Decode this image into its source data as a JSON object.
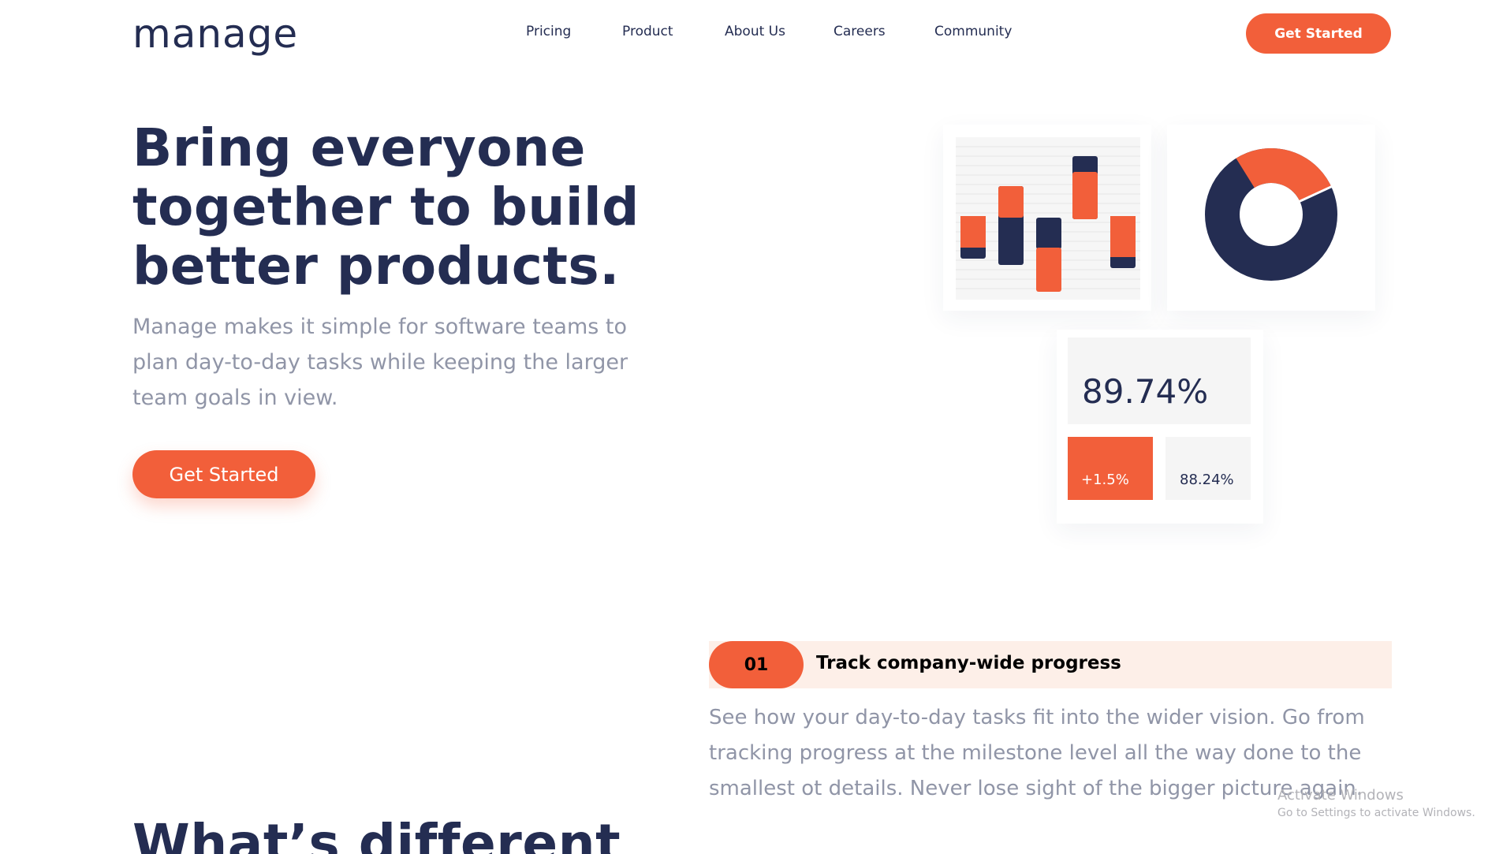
{
  "header": {
    "logo": "manage",
    "nav": [
      {
        "label": "Pricing"
      },
      {
        "label": "Product"
      },
      {
        "label": "About Us"
      },
      {
        "label": "Careers"
      },
      {
        "label": "Community"
      }
    ],
    "cta": "Get Started"
  },
  "hero": {
    "title": "Bring everyone together to build better products.",
    "subtitle": "Manage makes it simple for software teams to plan day-to-day tasks while keeping the larger team goals in view.",
    "cta": "Get Started"
  },
  "dashboard": {
    "stat_main": "89.74%",
    "stat_up": "+1.5%",
    "stat_down": "88.24%",
    "donut_orange_fraction": 0.27,
    "colors": {
      "accent": "#f25f3a",
      "navy": "#242d52",
      "tint": "#fdefe8"
    }
  },
  "feature": {
    "number": "01",
    "title": "Track company-wide progress",
    "text": "See how your day-to-day tasks fit into the wider vision. Go from tracking progress at the milestone level all the way done to the smallest ot details. Never lose sight of the bigger picture again."
  },
  "section": {
    "title": "What’s different"
  },
  "watermark": {
    "line1": "Activate Windows",
    "line2": "Go to Settings to activate Windows."
  }
}
